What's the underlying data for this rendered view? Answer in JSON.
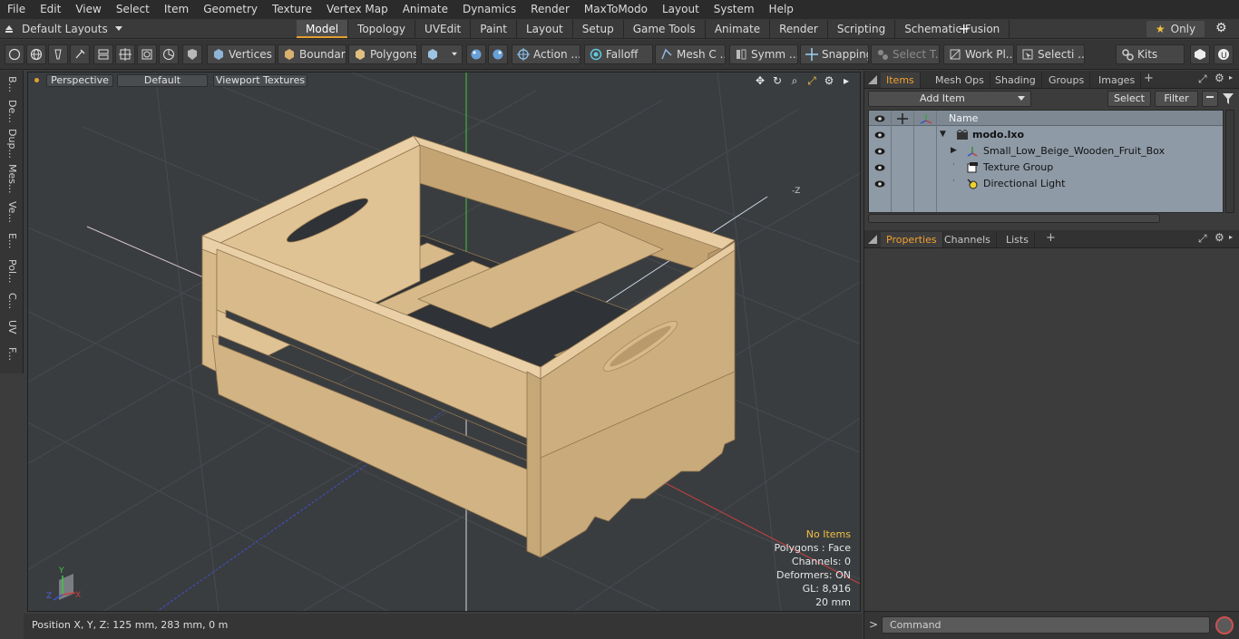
{
  "menu": [
    "File",
    "Edit",
    "View",
    "Select",
    "Item",
    "Geometry",
    "Texture",
    "Vertex Map",
    "Animate",
    "Dynamics",
    "Render",
    "MaxToModo",
    "Layout",
    "System",
    "Help"
  ],
  "layouts": {
    "label": "Default Layouts"
  },
  "tabs": [
    {
      "label": "Model",
      "active": true
    },
    {
      "label": "Topology"
    },
    {
      "label": "UVEdit"
    },
    {
      "label": "Paint"
    },
    {
      "label": "Layout"
    },
    {
      "label": "Setup"
    },
    {
      "label": "Game Tools"
    },
    {
      "label": "Animate"
    },
    {
      "label": "Render"
    },
    {
      "label": "Scripting"
    },
    {
      "label": "Schematic Fusion"
    }
  ],
  "only": {
    "label": "Only"
  },
  "toolbar": {
    "vertices": "Vertices",
    "boundary": "Boundary",
    "polygons": "Polygons",
    "action": "Action ...",
    "falloff": "Falloff",
    "mesh": "Mesh C ...",
    "symm": "Symm ...",
    "snapping": "Snapping",
    "select_t": "Select T...",
    "work_pl": "Work Pl...",
    "selecti": "Selecti ...",
    "kits": "Kits"
  },
  "left_tabs": [
    "B...",
    "De...",
    "Dup...",
    "Mes...",
    "Ve...",
    "E...",
    "Pol...",
    "C...",
    "UV",
    "F..."
  ],
  "viewport": {
    "view_mode": "Perspective",
    "shading": "Default",
    "textures": "Viewport Textures",
    "axis_label": "-Z",
    "info": {
      "items": "No Items",
      "polygons": "Polygons : Face",
      "channels": "Channels: 0",
      "deformers": "Deformers: ON",
      "gl": "GL: 8,916",
      "scale": "20 mm"
    },
    "mini_axis": {
      "x": "X",
      "y": "Y",
      "z": "Z"
    }
  },
  "status": {
    "position": "Position X, Y, Z:   125 mm, 283 mm, 0 m"
  },
  "items_panel": {
    "tabs": [
      "Items",
      "Mesh Ops",
      "Shading",
      "Groups",
      "Images"
    ],
    "add_item": "Add Item",
    "select": "Select",
    "filter": "Filter",
    "column_name": "Name",
    "rows": [
      {
        "label": "modo.lxo",
        "icon": "scene-icon"
      },
      {
        "label": "Small_Low_Beige_Wooden_Fruit_Box",
        "icon": "mesh-icon"
      },
      {
        "label": "Texture Group",
        "icon": "texture-group-icon"
      },
      {
        "label": "Directional Light",
        "icon": "light-icon"
      }
    ]
  },
  "properties_panel": {
    "tabs": [
      "Properties",
      "Channels",
      "Lists"
    ]
  },
  "command": {
    "placeholder": "Command"
  },
  "colors": {
    "accent": "#e0a030",
    "item_list_bg": "#8e9aa6",
    "viewport_bg": "#3a3d40",
    "wood_light": "#e3c69a",
    "wood_mid": "#cfb081",
    "wood_dark": "#a8895e"
  }
}
